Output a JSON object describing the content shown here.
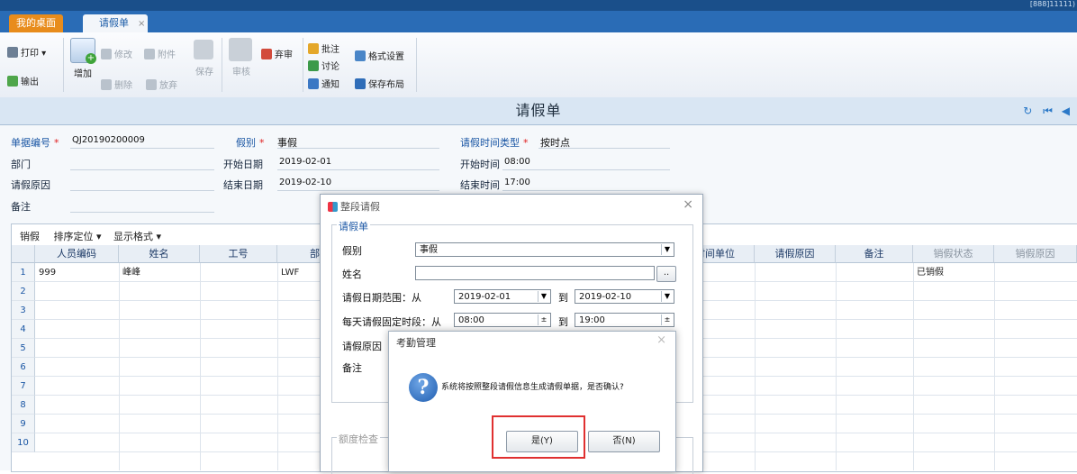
{
  "topbar": {
    "right_text": "[888]11111)"
  },
  "tabs": [
    {
      "label": "我的桌面"
    },
    {
      "label": "请假单",
      "close": "×"
    }
  ],
  "toolbar": {
    "print": "打印",
    "export": "输出",
    "add": "增加",
    "modify": "修改",
    "attach": "附件",
    "delete": "删除",
    "discard": "放弃",
    "save": "保存",
    "approve": "审核",
    "abandon": "弃审",
    "annotate": "批注",
    "discuss": "讨论",
    "notify": "通知",
    "format_settings": "格式设置",
    "save_layout": "保存布局"
  },
  "form": {
    "title": "请假单",
    "doc_no_label": "单据编号",
    "doc_no": "QJ20190200009",
    "leave_type_label": "假别",
    "leave_type": "事假",
    "time_type_label": "请假时间类型",
    "time_type": "按时点",
    "dept_label": "部门",
    "start_date_label": "开始日期",
    "start_date": "2019-02-01",
    "start_time_label": "开始时间",
    "start_time": "08:00",
    "reason_label": "请假原因",
    "end_date_label": "结束日期",
    "end_date": "2019-02-10",
    "end_time_label": "结束时间",
    "end_time": "17:00",
    "remark_label": "备注",
    "required_mark": "*"
  },
  "grid": {
    "toolbar": {
      "cancel": "销假",
      "sort": "排序定位",
      "display": "显示格式",
      "caret": "▾"
    },
    "headers": [
      "人员编码",
      "姓名",
      "工号",
      "部",
      "时间单位",
      "请假原因",
      "备注",
      "销假状态",
      "销假原因"
    ],
    "rows": [
      {
        "num": "1",
        "code": "999",
        "name": "峰峰",
        "id": "LWF",
        "status": "已销假"
      },
      {
        "num": "2"
      },
      {
        "num": "3"
      },
      {
        "num": "4"
      },
      {
        "num": "5"
      },
      {
        "num": "6"
      },
      {
        "num": "7"
      },
      {
        "num": "8"
      },
      {
        "num": "9"
      },
      {
        "num": "10"
      }
    ]
  },
  "dialog1": {
    "title": "整段请假",
    "close": "×",
    "group": "请假单",
    "leave_type_label": "假别",
    "leave_type": "事假",
    "name_label": "姓名",
    "name_btn": "..",
    "date_range_label": "请假日期范围：从",
    "date_from": "2019-02-01",
    "to": "到",
    "date_to": "2019-02-10",
    "time_range_label": "每天请假固定时段：从",
    "time_from": "08:00",
    "time_to": "19:00",
    "reason_label": "请假原因",
    "remark_label": "备注",
    "quota_group": "额度检查"
  },
  "dialog2": {
    "title": "考勤管理",
    "close": "×",
    "icon": "?",
    "message": "系统将按照整段请假信息生成请假单据，是否确认?",
    "yes": "是(Y)",
    "no": "否(N)"
  },
  "colors": {
    "tab_active": "#e88c1c",
    "accent": "#2a6cb6",
    "highlight": "#e03030"
  }
}
